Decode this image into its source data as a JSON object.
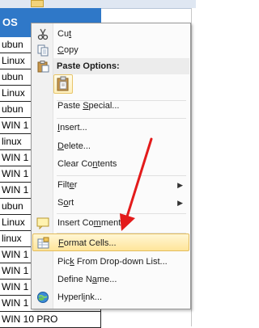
{
  "sheet": {
    "column_header": "OS",
    "rows": [
      "ubun",
      "Linux",
      "ubun",
      "Linux",
      "ubun",
      "WIN 1",
      "linux",
      "WIN 1",
      "WIN 1",
      "WIN 1",
      "ubun",
      "Linux",
      "linux",
      "WIN 1",
      "WIN 1",
      "WIN 1",
      "WIN 1",
      "WIN 10 PRO"
    ]
  },
  "menu": {
    "cut": {
      "pre": "Cu",
      "key": "t",
      "post": "",
      "icon": "scissors-icon"
    },
    "copy": {
      "pre": "",
      "key": "C",
      "post": "opy",
      "icon": "copy-icon"
    },
    "paste_options": {
      "label": "Paste Options:",
      "icon": "clipboard-icon"
    },
    "paste_special": {
      "pre": "Paste ",
      "key": "S",
      "post": "pecial..."
    },
    "insert": {
      "pre": "",
      "key": "I",
      "post": "nsert..."
    },
    "delete": {
      "pre": "",
      "key": "D",
      "post": "elete..."
    },
    "clear_contents": {
      "pre": "Clear Co",
      "key": "n",
      "post": "tents"
    },
    "filter": {
      "pre": "Filt",
      "key": "e",
      "post": "r"
    },
    "sort": {
      "pre": "S",
      "key": "o",
      "post": "rt"
    },
    "insert_comment": {
      "pre": "Insert Co",
      "key": "m",
      "post": "ment",
      "icon": "comment-icon"
    },
    "format_cells": {
      "pre": "",
      "key": "F",
      "post": "ormat Cells...",
      "icon": "format-cells-icon"
    },
    "pick_dropdown": {
      "pre": "Pic",
      "key": "k",
      "post": " From Drop-down List..."
    },
    "define_name": {
      "pre": "Define N",
      "key": "a",
      "post": "me..."
    },
    "hyperlink": {
      "pre": "Hyperl",
      "key": "i",
      "post": "nk...",
      "icon": "hyperlink-icon"
    }
  },
  "colors": {
    "header": "#2f78c8",
    "highlight": "#ffe59a",
    "arrow": "#e31b1b"
  }
}
